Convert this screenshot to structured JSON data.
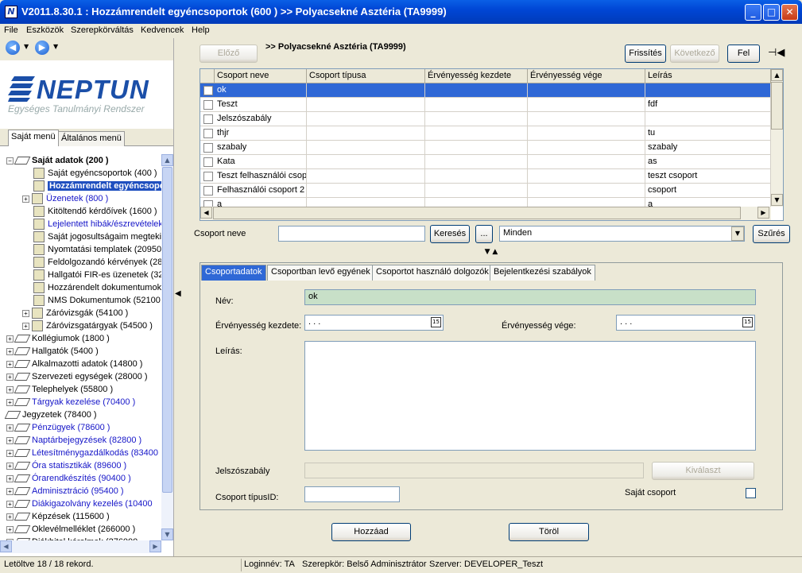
{
  "window": {
    "title": "V2011.8.30.1 : Hozzámrendelt egyéncsoportok (600  )  >> Polyacsekné Asztéria (TA9999)",
    "app_icon": "N"
  },
  "menu": [
    "File",
    "Eszközök",
    "Szerepkörváltás",
    "Kedvencek",
    "Help"
  ],
  "logo": {
    "name": "NEPTUN",
    "subtitle": "Egységes Tanulmányi Rendszer"
  },
  "menu_tabs": [
    "Saját menü",
    "Általános menü"
  ],
  "tree": [
    {
      "label": "Saját adatok (200  )",
      "level": 0,
      "expander": "−",
      "icon": "book",
      "bold": true,
      "blue": false
    },
    {
      "label": "Saját egyéncsoportok (400  )",
      "level": 2,
      "expander": "",
      "icon": "sheet",
      "blue": false
    },
    {
      "label": "Hozzámrendelt egyéncsoportok",
      "level": 2,
      "expander": "",
      "icon": "sheet",
      "selected": true
    },
    {
      "label": "Üzenetek (800  )",
      "level": 1,
      "expander": "+",
      "icon": "sheet",
      "blue": true
    },
    {
      "label": "Kitöltendő kérdőívek (1600  )",
      "level": 2,
      "expander": "",
      "icon": "sheet",
      "blue": false
    },
    {
      "label": "Lejelentett hibák/észrevételek",
      "level": 2,
      "expander": "",
      "icon": "sheet",
      "blue": true
    },
    {
      "label": "Saját jogosultságaim megtekintése",
      "level": 2,
      "expander": "",
      "icon": "sheet",
      "blue": false
    },
    {
      "label": "Nyomtatási templatek (20950",
      "level": 2,
      "expander": "",
      "icon": "sheet",
      "blue": false
    },
    {
      "label": "Feldolgozandó kérvények (28",
      "level": 2,
      "expander": "",
      "icon": "sheet",
      "blue": false
    },
    {
      "label": "Hallgatói FIR-es üzenetek (32",
      "level": 2,
      "expander": "",
      "icon": "sheet",
      "blue": false
    },
    {
      "label": "Hozzárendelt dokumentumok",
      "level": 2,
      "expander": "",
      "icon": "sheet",
      "blue": false
    },
    {
      "label": "NMS Dokumentumok (52100",
      "level": 2,
      "expander": "",
      "icon": "sheet",
      "blue": false
    },
    {
      "label": "Záróvizsgák (54100  )",
      "level": 1,
      "expander": "+",
      "icon": "sheet",
      "blue": false
    },
    {
      "label": "Záróvizsgatárgyak (54500  )",
      "level": 1,
      "expander": "+",
      "icon": "sheet",
      "blue": false
    },
    {
      "label": "Kollégiumok (1800  )",
      "level": 0,
      "expander": "+",
      "icon": "book",
      "blue": false
    },
    {
      "label": "Hallgatók (5400  )",
      "level": 0,
      "expander": "+",
      "icon": "book",
      "blue": false
    },
    {
      "label": "Alkalmazotti adatok (14800  )",
      "level": 0,
      "expander": "+",
      "icon": "book",
      "blue": false
    },
    {
      "label": "Szervezeti egységek (28000  )",
      "level": 0,
      "expander": "+",
      "icon": "book",
      "blue": false
    },
    {
      "label": "Telephelyek (55800  )",
      "level": 0,
      "expander": "+",
      "icon": "book",
      "blue": false
    },
    {
      "label": "Tárgyak kezelése (70400  )",
      "level": 0,
      "expander": "+",
      "icon": "book",
      "blue": true
    },
    {
      "label": "Jegyzetek (78400  )",
      "level": 0,
      "expander": "",
      "icon": "book",
      "blue": false
    },
    {
      "label": "Pénzügyek (78600  )",
      "level": 0,
      "expander": "+",
      "icon": "book",
      "blue": true
    },
    {
      "label": "Naptárbejegyzések (82800  )",
      "level": 0,
      "expander": "+",
      "icon": "book",
      "blue": true
    },
    {
      "label": "Létesítménygazdálkodás (83400",
      "level": 0,
      "expander": "+",
      "icon": "book",
      "blue": true
    },
    {
      "label": "Óra statisztikák (89600  )",
      "level": 0,
      "expander": "+",
      "icon": "book",
      "blue": true
    },
    {
      "label": "Órarendkészítés (90400  )",
      "level": 0,
      "expander": "+",
      "icon": "book",
      "blue": true
    },
    {
      "label": "Adminisztráció (95400  )",
      "level": 0,
      "expander": "+",
      "icon": "book",
      "blue": true
    },
    {
      "label": "Diákigazolvány kezelés (10400",
      "level": 0,
      "expander": "+",
      "icon": "book",
      "blue": true
    },
    {
      "label": "Képzések (115600  )",
      "level": 0,
      "expander": "+",
      "icon": "book",
      "blue": false
    },
    {
      "label": "Oklevélmelléklet (266000  )",
      "level": 0,
      "expander": "+",
      "icon": "book",
      "blue": false
    },
    {
      "label": "Diákhitel kérelmek (276000",
      "level": 0,
      "expander": "+",
      "icon": "book",
      "blue": false
    }
  ],
  "toolbar": {
    "prev": "Előző",
    "breadcrumb": ">> Polyacsekné Asztéria (TA9999)",
    "refresh": "Frissítés",
    "next": "Következő",
    "up": "Fel",
    "pin_icon": "pin-icon"
  },
  "grid": {
    "columns": [
      "Csoport neve",
      "Csoport típusa",
      "Érvényesség kezdete",
      "Érvényesség vége",
      "Leírás"
    ],
    "rows": [
      [
        "ok",
        "",
        "",
        "",
        ""
      ],
      [
        "Teszt",
        "",
        "",
        "",
        "fdf"
      ],
      [
        "Jelszószabály",
        "",
        "",
        "",
        ""
      ],
      [
        "thjr",
        "",
        "",
        "",
        "tu"
      ],
      [
        "szabaly",
        "",
        "",
        "",
        "szabaly"
      ],
      [
        "Kata",
        "",
        "",
        "",
        "as"
      ],
      [
        "Teszt felhasználói csoport",
        "",
        "",
        "",
        "teszt csoport"
      ],
      [
        "Felhasználói csoport 2",
        "",
        "",
        "",
        "csoport"
      ],
      [
        "a",
        "",
        "",
        "",
        "a"
      ]
    ]
  },
  "filter": {
    "label": "Csoport neve",
    "value": "",
    "search_btn": "Keresés",
    "more_btn": "...",
    "select_value": "Minden",
    "filter_btn": "Szűrés"
  },
  "detail_tabs": [
    "Csoportadatok",
    "Csoportban levő egyének",
    "Csoportot használó dolgozók",
    "Bejelentkezési szabályok"
  ],
  "form": {
    "name_label": "Név:",
    "name_value": "ok",
    "valid_from_label": "Érvényesség kezdete:",
    "valid_from_value": ".   .   .",
    "valid_to_label": "Érvényesség vége:",
    "valid_to_value": ".   .   .",
    "calendar_icon_text": "15",
    "desc_label": "Leírás:",
    "password_rule_label": "Jelszószabály",
    "select_btn": "Kiválaszt",
    "type_id_label": "Csoport típusID:",
    "own_group_label": "Saját csoport"
  },
  "actions": {
    "add": "Hozzáad",
    "delete": "Töröl"
  },
  "status": {
    "records": "Letöltve 18 / 18 rekord.",
    "login": "Loginnév: TA",
    "role": "Szerepkör: Belső Adminisztrátor",
    "server": "Szerver: DEVELOPER_Teszt"
  }
}
